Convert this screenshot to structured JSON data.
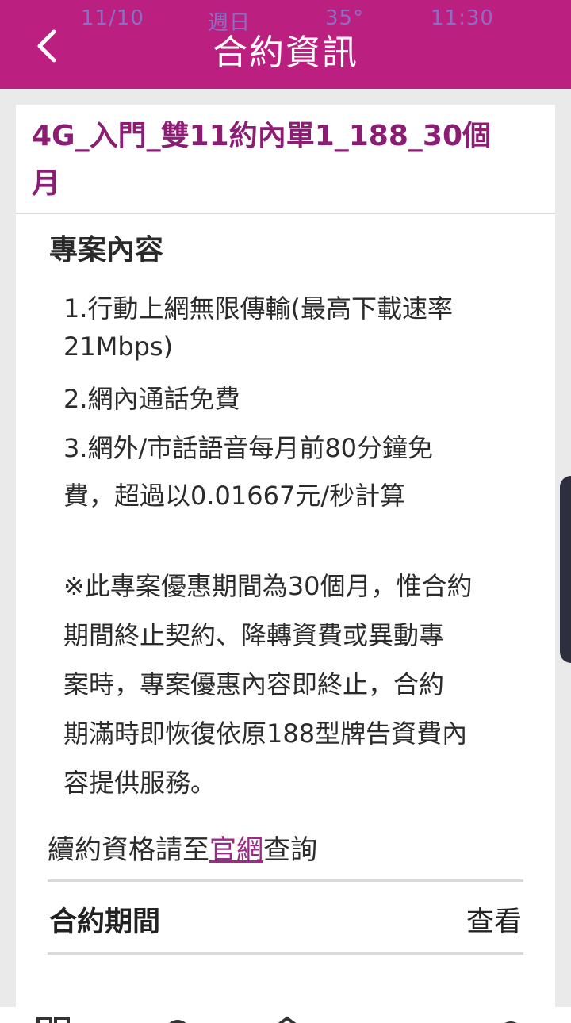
{
  "status_bar": {
    "date": "11/10",
    "weekday": "週日",
    "temperature": "35°",
    "time": "11:30"
  },
  "header": {
    "title": "合約資訊",
    "back_icon": "chevron-left-icon"
  },
  "plan": {
    "title_line1": "4G_入門_雙11約內單1_188_30個",
    "title_line2": "月"
  },
  "content": {
    "heading": "專案內容",
    "lines": [
      "1.行動上網無限傳輸(最高下載速率",
      "21Mbps)",
      "2.網內通話免費",
      "3.網外/市話語音每月前80分鐘免",
      "費，超過以0.01667元/秒計算"
    ],
    "notice_lines": [
      "※此專案優惠期間為30個月，惟合約",
      "期間終止契約、降轉資費或異動專",
      "案時，專案優惠內容即終止，合約",
      "期滿時即恢復依原188型牌告資費內",
      "容提供服務。"
    ]
  },
  "renewal": {
    "prefix": "續約資格請至",
    "link": "官網",
    "suffix": "查詢"
  },
  "contract_period": {
    "label": "合約期間",
    "action": "查看"
  },
  "bottom_nav": {
    "icons": [
      "grid-icon",
      "chat-icon",
      "home-icon",
      "user-icon"
    ]
  },
  "colors": {
    "header_bg": "#bb1f7f",
    "title_accent": "#8b1e74",
    "link": "#9c2a86",
    "status_text": "#8a6fc4"
  }
}
